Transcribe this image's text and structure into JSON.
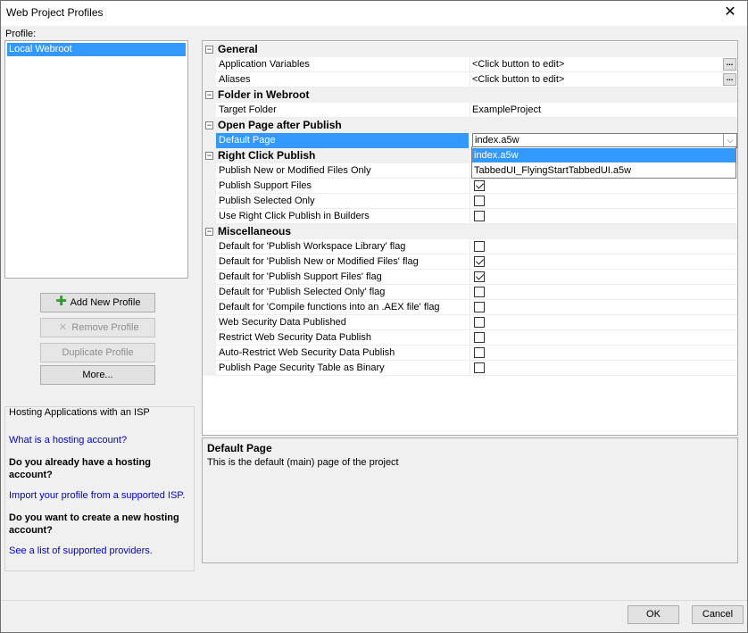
{
  "window": {
    "title": "Web Project Profiles",
    "close_glyph": "✕"
  },
  "profile": {
    "label": "Profile:",
    "items": [
      "Local Webroot"
    ]
  },
  "buttons": {
    "add": "Add New Profile",
    "remove": "Remove Profile",
    "duplicate": "Duplicate Profile",
    "more": "More..."
  },
  "hosting": {
    "title": "Hosting Applications with an ISP",
    "link1": "What is a hosting account?",
    "q1": "Do you already have a hosting account?",
    "link2": "Import your profile from a supported ISP.",
    "q2": "Do you want to create a new hosting account?",
    "link3": "See a list of supported providers."
  },
  "grid": {
    "categories": {
      "general": "General",
      "folder": "Folder in Webroot",
      "open_page": "Open Page after Publish",
      "right_click": "Right Click Publish",
      "misc": "Miscellaneous"
    },
    "toggle_glyph": "−",
    "ellipsis": "...",
    "props": {
      "app_vars": {
        "name": "Application Variables",
        "value": "<Click button to edit>"
      },
      "aliases": {
        "name": "Aliases",
        "value": "<Click button to edit>"
      },
      "target_folder": {
        "name": "Target Folder",
        "value": "ExampleProject"
      },
      "default_page": {
        "name": "Default Page",
        "value": "index.a5w"
      },
      "publish_new": {
        "name": "Publish New or Modified Files Only",
        "checked": true
      },
      "publish_support": {
        "name": "Publish Support Files",
        "checked": true
      },
      "publish_selected": {
        "name": "Publish Selected Only",
        "checked": false
      },
      "use_right_click": {
        "name": "Use Right Click Publish in Builders",
        "checked": false
      },
      "m1": {
        "name": "Default for 'Publish Workspace Library' flag",
        "checked": false
      },
      "m2": {
        "name": "Default for 'Publish New or Modified Files' flag",
        "checked": true
      },
      "m3": {
        "name": "Default for 'Publish Support Files' flag",
        "checked": true
      },
      "m4": {
        "name": "Default for 'Publish Selected Only' flag",
        "checked": false
      },
      "m5": {
        "name": "Default for 'Compile functions into an .AEX file' flag",
        "checked": false
      },
      "m6": {
        "name": "Web Security Data Published",
        "checked": false
      },
      "m7": {
        "name": "Restrict Web Security Data Publish",
        "checked": false
      },
      "m8": {
        "name": "Auto-Restrict Web Security Data Publish",
        "checked": false
      },
      "m9": {
        "name": "Publish Page Security Table as Binary",
        "checked": false
      }
    },
    "dropdown_options": [
      "index.a5w",
      "TabbedUI_FlyingStartTabbedUI.a5w"
    ],
    "dropdown_arrow": "⌵"
  },
  "description": {
    "title": "Default Page",
    "text": "This is the default (main) page of the project"
  },
  "footer": {
    "ok": "OK",
    "cancel": "Cancel"
  }
}
